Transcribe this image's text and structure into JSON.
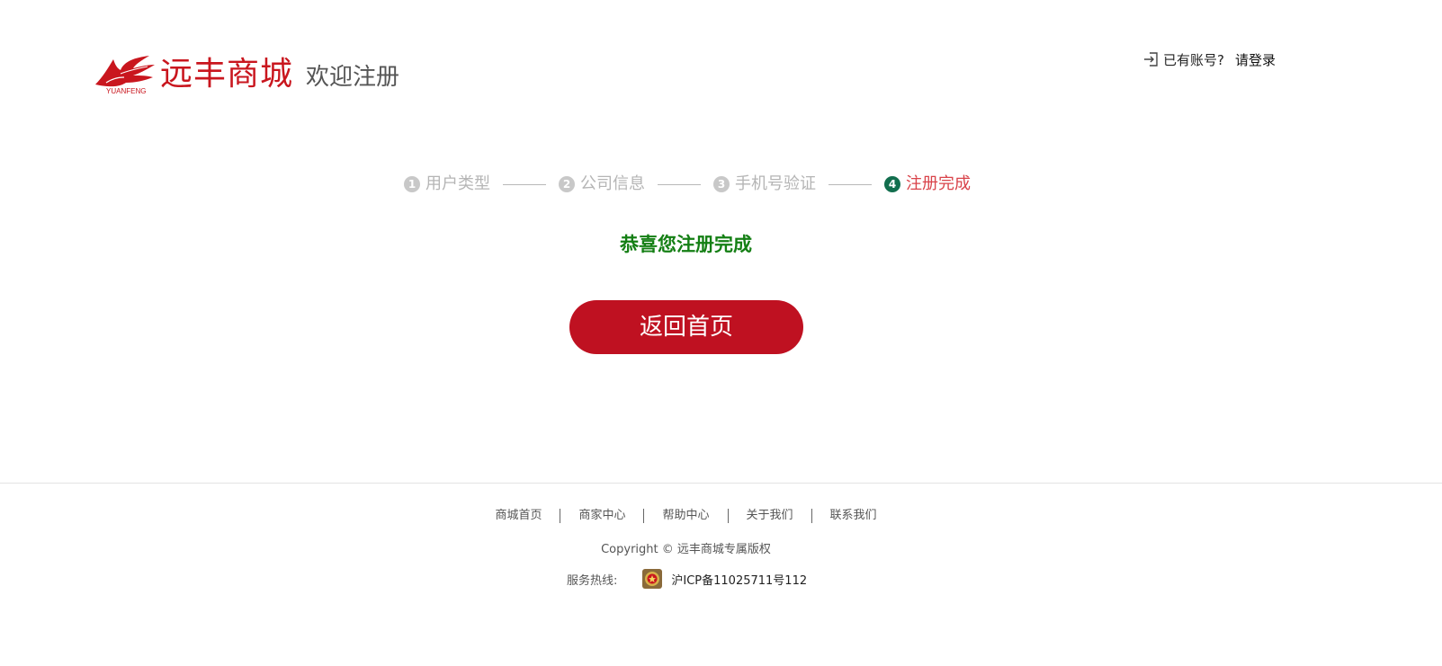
{
  "header": {
    "brand": "远丰商城",
    "brand_en": "YUANFENG",
    "welcome": "欢迎注册",
    "login_question": "已有账号?",
    "login_link": "请登录"
  },
  "steps": [
    {
      "num": "1",
      "label": "用户类型",
      "active": false
    },
    {
      "num": "2",
      "label": "公司信息",
      "active": false
    },
    {
      "num": "3",
      "label": "手机号验证",
      "active": false
    },
    {
      "num": "4",
      "label": "注册完成",
      "active": true
    }
  ],
  "main": {
    "success_message": "恭喜您注册完成",
    "home_button": "返回首页"
  },
  "footer": {
    "links": [
      "商城首页",
      "商家中心",
      "帮助中心",
      "关于我们",
      "联系我们"
    ],
    "copyright": "Copyright © 远丰商城专属版权",
    "hotline": "服务热线:",
    "icp": "沪ICP备11025711号112"
  },
  "colors": {
    "brand_red": "#c9161e",
    "button_red": "#bf1121",
    "success_green": "#147f14",
    "step_active": "#126e4e"
  }
}
